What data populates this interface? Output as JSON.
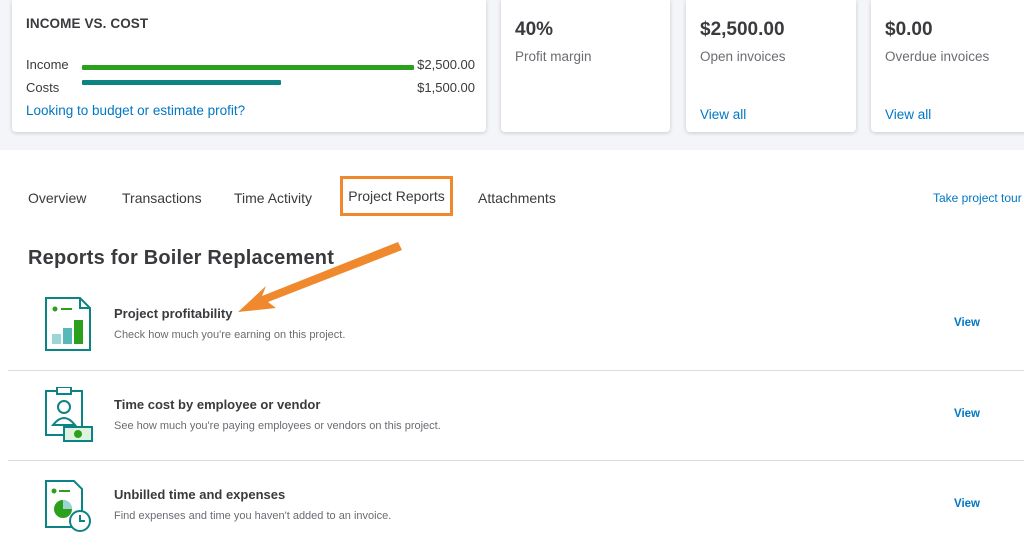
{
  "income_vs_cost": {
    "title": "INCOME VS. COST",
    "income_label": "Income",
    "income_value": "$2,500.00",
    "costs_label": "Costs",
    "costs_value": "$1,500.00",
    "income_amount": 2500,
    "costs_amount": 1500,
    "income_color": "#2ca01c",
    "costs_color": "#0d8484",
    "budget_link": "Looking to budget or estimate profit?"
  },
  "metrics": [
    {
      "value": "40%",
      "label": "Profit margin"
    },
    {
      "value": "$2,500.00",
      "label": "Open invoices",
      "link": "View all"
    },
    {
      "value": "$0.00",
      "label": "Overdue invoices",
      "link": "View all"
    }
  ],
  "tabs": [
    {
      "label": "Overview"
    },
    {
      "label": "Transactions"
    },
    {
      "label": "Time Activity"
    },
    {
      "label": "Project Reports",
      "active": true
    },
    {
      "label": "Attachments"
    }
  ],
  "take_tour": "Take project tour",
  "section_title": "Reports for Boiler Replacement",
  "reports": [
    {
      "title": "Project profitability",
      "subtitle": "Check how much you're earning on this project.",
      "action": "View",
      "icon": "profitability-report-icon"
    },
    {
      "title": "Time cost by employee or vendor",
      "subtitle": "See how much you're paying employees or vendors on this project.",
      "action": "View",
      "icon": "employee-badge-icon"
    },
    {
      "title": "Unbilled time and expenses",
      "subtitle": "Find expenses and time you haven't added to an invoice.",
      "action": "View",
      "icon": "unbilled-clock-icon"
    }
  ],
  "colors": {
    "accent_link": "#0077c5",
    "highlight": "#f0892d",
    "icon_teal": "#0d8484",
    "icon_green": "#2ca01c"
  }
}
